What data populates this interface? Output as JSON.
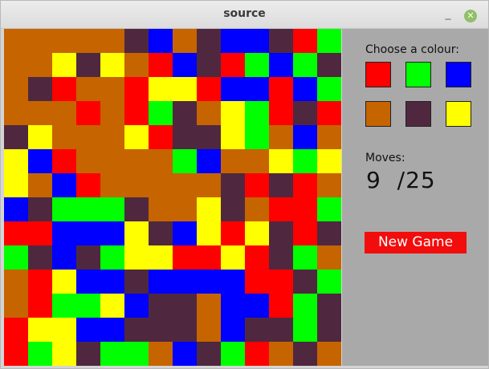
{
  "window": {
    "title": "source",
    "minimize_glyph": "_",
    "close_glyph": "✕"
  },
  "palette": {
    "O": "#c66400",
    "P": "#4f2840",
    "B": "#0000ff",
    "R": "#ff0000",
    "G": "#00ff00",
    "Y": "#ffff00"
  },
  "board": {
    "rows": [
      "OOOOOPBOPBBPRG",
      "OOYPYORBPRGBGP",
      "OPROORYYRBBRBG",
      "OOORORGPOYGRPR",
      "PYOOOYRPPYGOBO",
      "YBROOOOGBOOYGY",
      "YOBROOOOOPRPRO",
      "BPGGGPOOYPORRG",
      "RRBBBYPBYRYPRP",
      "GPBPGYYRRYRPGO",
      "ORYBBPBBBBRRPG",
      "ORGGYBPPOBBRGP",
      "RYYBBPPPOBPPGP",
      "RGYPGGOBPGROPO"
    ]
  },
  "sidebar": {
    "choose_label": "Choose a colour:",
    "colours": [
      {
        "name": "red",
        "color": "#ff0000"
      },
      {
        "name": "green",
        "color": "#00ff00"
      },
      {
        "name": "blue",
        "color": "#0000ff"
      },
      {
        "name": "orange",
        "color": "#c66400"
      },
      {
        "name": "purple",
        "color": "#4f2840"
      },
      {
        "name": "yellow",
        "color": "#ffff00"
      }
    ],
    "moves_label": "Moves:",
    "moves_used": "9",
    "moves_total": "/25",
    "new_game_label": "New Game"
  }
}
